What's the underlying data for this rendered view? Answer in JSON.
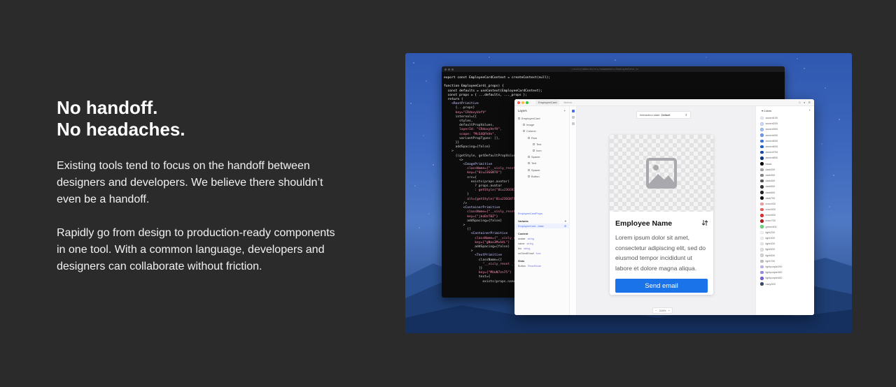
{
  "hero": {
    "headline_line1": "No handoff.",
    "headline_line2": "No headaches.",
    "paragraph1": "Existing tools tend to focus on the handoff between designers and developers. We believe there shouldn’t even be a handoff.",
    "paragraph2": "Rapidly go from design to production-ready components in one tool. With a common language, developers and designers can collaborate without friction."
  },
  "code_editor": {
    "path": "~/visly/website/src/components/EmployeeCard.js",
    "lines": [
      "export const EmployeeCardContext = createContext(null);",
      "",
      "function EmployeeCard(_props) {",
      "  const defaults = useContext(EmployeeCardContext);",
      "  const props = { ...defaults, ..._props };",
      "  return (",
      "    <RootPrimitive",
      "      {...props}",
      "      key=\"CRdoxyVefV\"",
      "      internal={{",
      "        styles,",
      "        defaultPropValues,",
      "        layerId: \"CRdoxyVefV\",",
      "        scope: \"McG4QFkVe\",",
      "        variantPropTypes: [],",
      "      }}",
      "      addSpacing={false}",
      "    >",
      "      {(getStyle, getDefaultPropValue) => (",
      "        <>",
      "          <ImagePrimitive",
      "            className={\"__visly_reset",
      "            key={\"8iuJ3GGN7U\"}",
      "            src={",
      "              exists(props.avatar)",
      "                ? props.avatar",
      "                : getStyle(\"8iuJ3GGN7U",
      "            }",
      "            alt={getStyle(\"8iuJ3GGN7U",
      "          />",
      "          <ContainerPrimitive",
      "            className={\"__visly_reset",
      "            key={\"jkoDzT8Z\"}",
      "            addSpacing={false}",
      "          >",
      "            {[",
      "              <ContainerPrimitive",
      "                className={\"__visly_res",
      "                key={\"gNoo3MvA4L\"}",
      "                addSpacing={false}",
      "              >",
      "                <TextPrimitive",
      "                  className={[",
      "                    \"__visly_reset _\"",
      "                  ]}",
      "                  key={\"MUuN7zn75\"}",
      "                  text={",
      "                    exists(props.name)"
    ]
  },
  "design_tool": {
    "tab_active": "EmployeeCard",
    "tab_inactive": "Button",
    "layers_title": "Layers",
    "layers": [
      {
        "label": "EmployeeCard",
        "depth": 0
      },
      {
        "label": "Image",
        "depth": 1
      },
      {
        "label": "Column",
        "depth": 1
      },
      {
        "label": "Row",
        "depth": 2
      },
      {
        "label": "Text",
        "depth": 3
      },
      {
        "label": "Icon",
        "depth": 3
      },
      {
        "label": "Spacer",
        "depth": 2
      },
      {
        "label": "Text",
        "depth": 2
      },
      {
        "label": "Spacer",
        "depth": 2
      },
      {
        "label": "Button",
        "depth": 2
      }
    ],
    "props_link": "EmployeeCardProps",
    "variants_label": "Variants",
    "variant_selected": "EmployeeCard - base",
    "content_label": "Content",
    "content_props": [
      {
        "name": "avatar",
        "type": "string"
      },
      {
        "name": "name",
        "type": "string"
      },
      {
        "name": "bio",
        "type": "string"
      },
      {
        "name": "onSendEmail",
        "type": "func"
      }
    ],
    "slots_label": "Slots",
    "slot_item": {
      "name": "Button",
      "type": "ReactNode"
    },
    "interaction_state_label": "Interaction state",
    "interaction_state_value": "Default",
    "zoom": "216%",
    "card": {
      "name": "Employee Name",
      "bio": "Lorem ipsum dolor sit amet, consectetur adipiscing elit, sed do eiusmod tempor incididunt ut labore et dolore magna aliqua.",
      "button_label": "Send email"
    },
    "colors_title": "Colors",
    "colors": [
      {
        "name": "accent100",
        "hex": "#e8eefc"
      },
      {
        "name": "accent200",
        "hex": "#cddcfa"
      },
      {
        "name": "accent300",
        "hex": "#a3c0f5"
      },
      {
        "name": "accent400",
        "hex": "#6f9bef"
      },
      {
        "name": "accent500",
        "hex": "#3b76e8"
      },
      {
        "name": "accent600",
        "hex": "#1a5fd6"
      },
      {
        "name": "accent700",
        "hex": "#134cb0"
      },
      {
        "name": "accent800",
        "hex": "#0e3a88"
      },
      {
        "name": "black",
        "hex": "#000000"
      },
      {
        "name": "dark200",
        "hex": "#aaaaaa"
      },
      {
        "name": "dark300",
        "hex": "#888888"
      },
      {
        "name": "dark400",
        "hex": "#555555"
      },
      {
        "name": "dark500",
        "hex": "#333333"
      },
      {
        "name": "dark600",
        "hex": "#222222"
      },
      {
        "name": "dark700",
        "hex": "#111111"
      },
      {
        "name": "error400",
        "hex": "#f6a3a3"
      },
      {
        "name": "error500",
        "hex": "#ef5f5f"
      },
      {
        "name": "error600",
        "hex": "#e03131"
      },
      {
        "name": "error700",
        "hex": "#b31f1f"
      },
      {
        "name": "green400",
        "hex": "#69db7c"
      },
      {
        "name": "light200",
        "hex": "#fafafa"
      },
      {
        "name": "light300",
        "hex": "#f5f5f5"
      },
      {
        "name": "light400",
        "hex": "#eeeeee"
      },
      {
        "name": "light500",
        "hex": "#e4e4e4"
      },
      {
        "name": "light600",
        "hex": "#d6d6d6"
      },
      {
        "name": "light700",
        "hex": "#c6c6c6"
      },
      {
        "name": "lightpurple200",
        "hex": "#c5b8f5"
      },
      {
        "name": "lightpurple300",
        "hex": "#9f8ce8"
      },
      {
        "name": "lightpurple400",
        "hex": "#7a63db"
      },
      {
        "name": "navy300",
        "hex": "#3a4a6b"
      }
    ]
  }
}
